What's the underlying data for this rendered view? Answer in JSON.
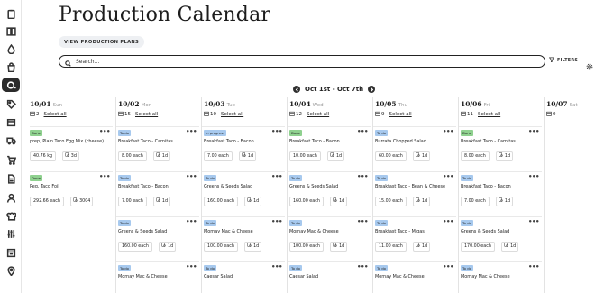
{
  "sidebar": {
    "items": [
      {
        "icon": "clipboard-icon",
        "active": false
      },
      {
        "icon": "book-icon",
        "active": false
      },
      {
        "icon": "drop-icon",
        "active": false
      },
      {
        "icon": "bag-icon",
        "active": false
      },
      {
        "icon": "calendar-pan-icon",
        "active": true
      },
      {
        "icon": "tag-icon",
        "active": false
      },
      {
        "icon": "box-icon",
        "active": false
      },
      {
        "icon": "truck-icon",
        "active": false
      },
      {
        "icon": "cart-icon",
        "active": false
      },
      {
        "icon": "document-icon",
        "active": false
      },
      {
        "icon": "user-icon",
        "active": false
      },
      {
        "icon": "chef-icon",
        "active": false
      },
      {
        "icon": "sliders-icon",
        "active": false
      },
      {
        "icon": "register-icon",
        "active": false
      },
      {
        "icon": "pin-icon",
        "active": false
      }
    ]
  },
  "header": {
    "title": "Production Calendar",
    "view_plans_label": "VIEW PRODUCTION PLANS"
  },
  "search": {
    "placeholder": "Search...",
    "value": ""
  },
  "toolbar": {
    "filters_label": "FILTERS"
  },
  "week": {
    "range": "Oct 1st - Oct 7th"
  },
  "colors": {
    "done": "#8fd18f",
    "todo": "#a7c9ee",
    "in_progress": "#a7c9ee"
  },
  "days": [
    {
      "date": "10/01",
      "dow": "Sun",
      "count": "2",
      "select_label": "Select all",
      "cards": [
        {
          "status": "Done",
          "name": "prep, Plain Taco Egg Mix (cheese)",
          "qty": "40.76 kg",
          "life": "3d"
        },
        {
          "status": "Done",
          "name": "Peg, Taco Foil",
          "qty": "292.66 each",
          "life": "3004"
        }
      ]
    },
    {
      "date": "10/02",
      "dow": "Mon",
      "count": "15",
      "select_label": "Select all",
      "cards": [
        {
          "status": "To do",
          "name": "Breakfast Taco - Carnitas",
          "qty": "8.00 each",
          "life": "1d"
        },
        {
          "status": "To do",
          "name": "Breakfast Taco - Bacon",
          "qty": "7.00 each",
          "life": "1d"
        },
        {
          "status": "To do",
          "name": "Greens & Seeds Salad",
          "qty": "160.00 each",
          "life": "1d"
        },
        {
          "status": "To do",
          "name": "Mornay Mac & Cheese",
          "qty": "",
          "life": ""
        }
      ]
    },
    {
      "date": "10/03",
      "dow": "Tue",
      "count": "10",
      "select_label": "Select all",
      "cards": [
        {
          "status": "In progress",
          "name": "Breakfast Taco - Bacon",
          "qty": "7.00 each",
          "life": "1d"
        },
        {
          "status": "To do",
          "name": "Greens & Seeds Salad",
          "qty": "160.00 each",
          "life": "1d"
        },
        {
          "status": "To do",
          "name": "Mornay Mac & Cheese",
          "qty": "100.00 each",
          "life": "1d"
        },
        {
          "status": "To do",
          "name": "Caesar Salad",
          "qty": "",
          "life": ""
        }
      ]
    },
    {
      "date": "10/04",
      "dow": "Wed",
      "count": "12",
      "select_label": "Select all",
      "cards": [
        {
          "status": "Done",
          "name": "Breakfast Taco - Bacon",
          "qty": "10.00 each",
          "life": "1d"
        },
        {
          "status": "To do",
          "name": "Greens & Seeds Salad",
          "qty": "160.00 each",
          "life": "1d"
        },
        {
          "status": "To do",
          "name": "Mornay Mac & Cheese",
          "qty": "100.00 each",
          "life": "1d"
        },
        {
          "status": "To do",
          "name": "Caesar Salad",
          "qty": "",
          "life": ""
        }
      ]
    },
    {
      "date": "10/05",
      "dow": "Thu",
      "count": "9",
      "select_label": "Select all",
      "cards": [
        {
          "status": "To do",
          "name": "Burrata Chopped Salad",
          "qty": "60.00 each",
          "life": "1d"
        },
        {
          "status": "To do",
          "name": "Breakfast Taco - Bean & Cheese",
          "qty": "15.00 each",
          "life": "1d"
        },
        {
          "status": "To do",
          "name": "Breakfast Taco - Migas",
          "qty": "11.00 each",
          "life": "1d"
        },
        {
          "status": "To do",
          "name": "Mornay Mac & Cheese",
          "qty": "",
          "life": ""
        }
      ]
    },
    {
      "date": "10/06",
      "dow": "Fri",
      "count": "11",
      "select_label": "Select all",
      "cards": [
        {
          "status": "Done",
          "name": "Breakfast Taco - Carnitas",
          "qty": "8.00 each",
          "life": "1d"
        },
        {
          "status": "To do",
          "name": "Breakfast Taco - Bacon",
          "qty": "7.00 each",
          "life": "1d"
        },
        {
          "status": "To do",
          "name": "Greens & Seeds Salad",
          "qty": "170.00 each",
          "life": "1d"
        },
        {
          "status": "To do",
          "name": "Mornay Mac & Cheese",
          "qty": "",
          "life": ""
        }
      ]
    },
    {
      "date": "10/07",
      "dow": "Sat",
      "count": "0",
      "select_label": "",
      "cards": []
    }
  ]
}
